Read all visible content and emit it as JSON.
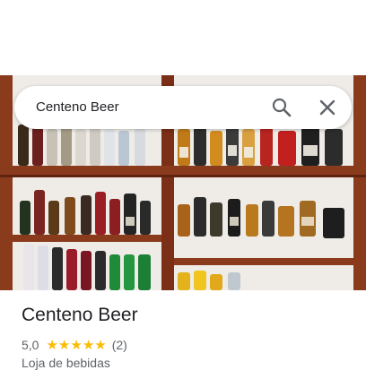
{
  "search": {
    "query": "Centeno Beer",
    "search_icon": "magnifier-icon",
    "close_icon": "close-icon"
  },
  "place": {
    "name": "Centeno Beer",
    "rating": "5,0",
    "stars": 5,
    "review_count": "(2)",
    "category": "Loja de bebidas"
  },
  "colors": {
    "star": "#fbbc04",
    "title": "#202124",
    "secondary_text": "#5f6368",
    "shelf_wood": "#8a3b1c"
  }
}
